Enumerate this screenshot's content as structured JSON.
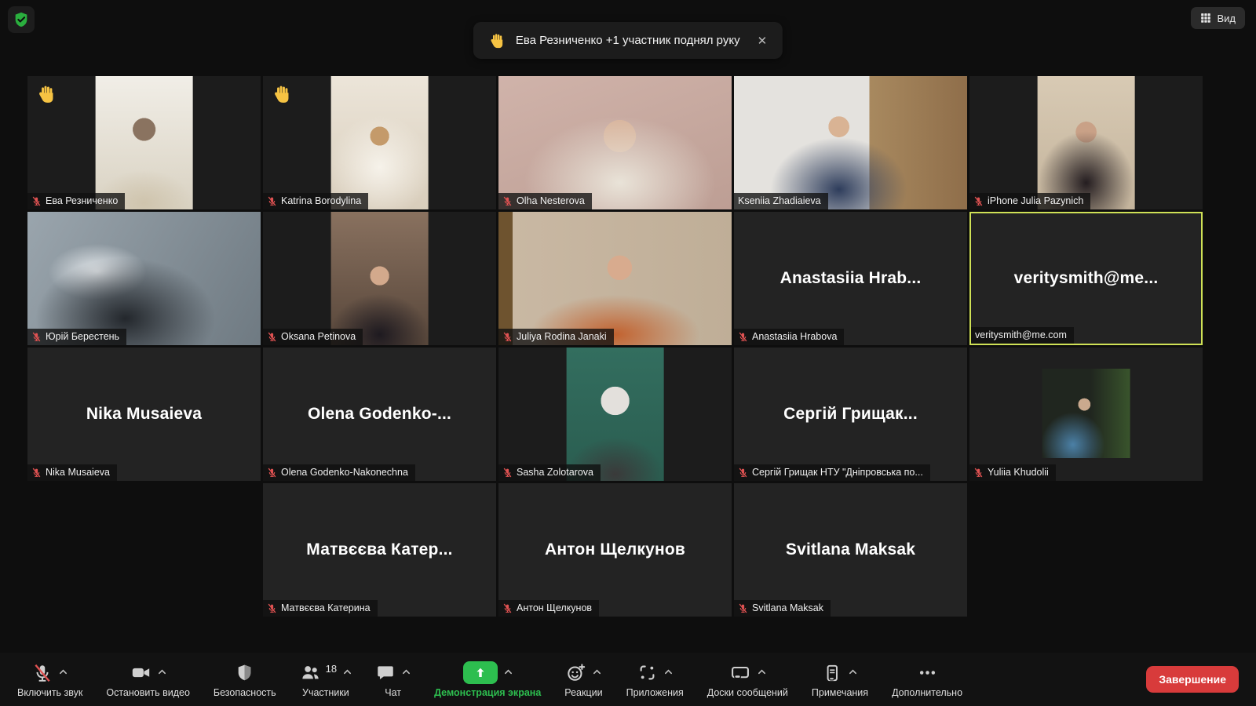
{
  "colors": {
    "accent_green": "#2dbe4f",
    "end_red": "#d83b3b",
    "active_border": "#cfe156",
    "muted_red": "#e05252",
    "hand_yellow": "#f6c343",
    "shield_green": "#2aaf3e"
  },
  "header": {
    "view_label": "Вид",
    "notification": {
      "icon": "raised-hand",
      "text": "Ева Резниченко +1 участник поднял руку",
      "close_glyph": "✕"
    }
  },
  "participants": [
    {
      "name_label": "Ева Резниченко",
      "muted": true,
      "hand_raised": true,
      "video": "centered",
      "style": "eva"
    },
    {
      "name_label": "Katrina Borodylina",
      "muted": true,
      "hand_raised": true,
      "video": "centered",
      "style": "cat"
    },
    {
      "name_label": "Olha Nesterova",
      "muted": true,
      "hand_raised": false,
      "video": "full",
      "style": "olha"
    },
    {
      "name_label": "Kseniia Zhadiaieva",
      "muted": false,
      "hand_raised": false,
      "video": "full",
      "style": "kseniia"
    },
    {
      "name_label": "iPhone Julia Pazynich",
      "muted": true,
      "hand_raised": false,
      "video": "centered",
      "style": "julia"
    },
    {
      "name_label": "Юрій Берестень",
      "muted": true,
      "hand_raised": false,
      "video": "full",
      "style": "yurii"
    },
    {
      "name_label": "Oksana Petinova",
      "muted": true,
      "hand_raised": false,
      "video": "centered",
      "style": "oksana"
    },
    {
      "name_label": "Juliya Rodina Janaki",
      "muted": true,
      "hand_raised": false,
      "video": "full",
      "style": "juliya"
    },
    {
      "name_label": "Anastasiia Hrabova",
      "muted": true,
      "hand_raised": false,
      "video": "none",
      "center_name": "Anastasiia Hrab..."
    },
    {
      "name_label": "veritysmith@me.com",
      "muted": false,
      "hand_raised": false,
      "video": "none",
      "center_name": "veritysmith@me...",
      "active": true
    },
    {
      "name_label": "Nika Musaieva",
      "muted": true,
      "hand_raised": false,
      "video": "none",
      "center_name": "Nika Musaieva"
    },
    {
      "name_label": "Olena Godenko-Nakonechna",
      "muted": true,
      "hand_raised": false,
      "video": "none",
      "center_name": "Olena  Godenko-..."
    },
    {
      "name_label": "Sasha Zolotarova",
      "muted": true,
      "hand_raised": false,
      "video": "centered",
      "style": "sasha"
    },
    {
      "name_label": "Сергій Грищак НТУ \"Дніпровська по...",
      "muted": true,
      "hand_raised": false,
      "video": "none",
      "center_name": "Сергій Грищак..."
    },
    {
      "name_label": "Yuliia Khudolii",
      "muted": true,
      "hand_raised": false,
      "video": "small",
      "style": "yuliia"
    },
    {
      "name_label": "Матвєєва Катерина",
      "muted": true,
      "hand_raised": false,
      "video": "none",
      "center_name": "Матвєєва Катер...",
      "grid_column": "2"
    },
    {
      "name_label": "Антон Щелкунов",
      "muted": true,
      "hand_raised": false,
      "video": "none",
      "center_name": "Антон Щелкунов"
    },
    {
      "name_label": "Svitlana Maksak",
      "muted": true,
      "hand_raised": false,
      "video": "none",
      "center_name": "Svitlana Maksak"
    }
  ],
  "toolbar": {
    "items": [
      {
        "label": "Включить звук",
        "icon": "mic-muted",
        "chevron": true
      },
      {
        "label": "Остановить видео",
        "icon": "camera",
        "chevron": true
      },
      {
        "label": "Безопасность",
        "icon": "security-shield",
        "chevron": false
      },
      {
        "label": "Участники",
        "icon": "participants",
        "badge": "18",
        "chevron": true
      },
      {
        "label": "Чат",
        "icon": "chat",
        "chevron": true
      },
      {
        "label": "Демонстрация экрана",
        "icon": "share-screen",
        "chevron": true,
        "green": true
      },
      {
        "label": "Реакции",
        "icon": "reactions",
        "chevron": true
      },
      {
        "label": "Приложения",
        "icon": "apps",
        "chevron": true
      },
      {
        "label": "Доски сообщений",
        "icon": "whiteboard",
        "chevron": true
      },
      {
        "label": "Примечания",
        "icon": "notes",
        "chevron": true
      },
      {
        "label": "Дополнительно",
        "icon": "more",
        "chevron": false
      }
    ],
    "end_label": "Завершение"
  }
}
